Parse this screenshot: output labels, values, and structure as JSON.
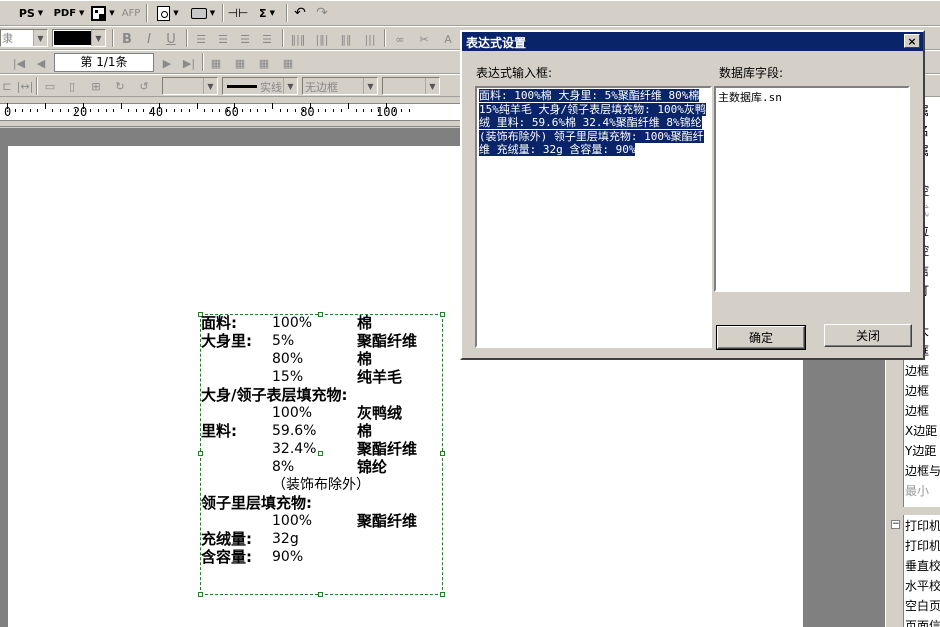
{
  "toolbar1": {
    "ps_label": "PS",
    "pdf_label": "PDF",
    "afp_label": "AFP",
    "sigma_label": "Σ"
  },
  "toolbar2": {
    "font_combo_text": "隶",
    "bold_label": "B",
    "italic_label": "I",
    "underline_label": "U",
    "record_nav_label": "第 1/1条"
  },
  "toolbar3": {
    "line_style_label": "实线",
    "border_label": "无边框"
  },
  "ruler": {
    "labels": [
      "0",
      "20",
      "40",
      "60",
      "80",
      "100"
    ]
  },
  "label_content": {
    "lines": [
      {
        "label": "面料:",
        "pct": "100%",
        "material": "棉"
      },
      {
        "label": "大身里:",
        "pct": "5%",
        "material": "聚酯纤维"
      },
      {
        "label": "",
        "pct": "80%",
        "material": "棉"
      },
      {
        "label": "",
        "pct": "15%",
        "material": "纯羊毛"
      },
      {
        "label": "大身/领子表层填充物:",
        "pct": "",
        "material": ""
      },
      {
        "label": "",
        "pct": "100%",
        "material": "灰鸭绒"
      },
      {
        "label": "里料:",
        "pct": "59.6%",
        "material": "棉"
      },
      {
        "label": "",
        "pct": "32.4%",
        "material": "聚酯纤维"
      },
      {
        "label": "",
        "pct": "8%",
        "material": "锦纶"
      },
      {
        "label": "",
        "pct": "（装饰布除外）",
        "material": ""
      },
      {
        "label": "领子里层填充物:",
        "pct": "",
        "material": ""
      },
      {
        "label": "",
        "pct": "100%",
        "material": "聚酯纤维"
      },
      {
        "label": "充绒量:",
        "pct": "32g",
        "material": ""
      },
      {
        "label": "含容量:",
        "pct": "90%",
        "material": ""
      }
    ]
  },
  "dialog": {
    "title": "表达式设置",
    "close_label": "×",
    "expression_label": "表达式输入框:",
    "db_fields_label": "数据库字段:",
    "expression_value": "面料: 100%棉 大身里: 5%聚酯纤维 80%棉 15%纯羊毛 大身/领子表层填充物: 100%灰鸭绒 里料: 59.6%棉 32.4%聚酯纤维 8%锦纶 (装饰布除外) 领子里层填充物: 100%聚酯纤维 充绒量: 32g 含容量: 90%",
    "db_field_items": [
      "主数据库.sn"
    ],
    "ok_label": "确定",
    "cancel_label": "关闭"
  },
  "right_panel": {
    "items": [
      {
        "text": "家属",
        "disabled": false
      },
      {
        "text": "签名",
        "disabled": false
      },
      {
        "text": "字属",
        "disabled": false
      },
      {
        "text": "限",
        "disabled": false
      },
      {
        "text": "印控",
        "disabled": false
      },
      {
        "text": "公式",
        "disabled": true
      },
      {
        "text": "定位",
        "disabled": false
      },
      {
        "text": "圆控",
        "disabled": false
      },
      {
        "text": "人信",
        "disabled": false
      },
      {
        "text": "页打",
        "disabled": false
      },
      {
        "text": "性",
        "disabled": false
      },
      {
        "text": "最大",
        "disabled": false
      },
      {
        "text": "边框",
        "disabled": false
      },
      {
        "text": "边框",
        "disabled": false
      },
      {
        "text": "边框",
        "disabled": false
      },
      {
        "text": "边框",
        "disabled": false
      },
      {
        "text": "X边距",
        "disabled": false
      },
      {
        "text": "Y边距",
        "disabled": false
      },
      {
        "text": "边框与",
        "disabled": false
      },
      {
        "text": "最小",
        "disabled": true
      }
    ],
    "group2": [
      {
        "text": "打印机"
      },
      {
        "text": "打印机"
      },
      {
        "text": "垂直校"
      },
      {
        "text": "水平校"
      },
      {
        "text": "空白页"
      },
      {
        "text": "页面信息"
      }
    ]
  },
  "colors": {
    "title_bar": "#0a246a",
    "selection": "#0a246a",
    "face": "#d4d0c8"
  }
}
